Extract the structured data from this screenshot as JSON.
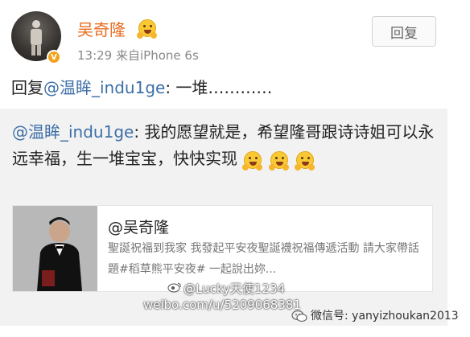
{
  "post": {
    "author": "吴奇隆",
    "time_source": "13:29  来自iPhone 6s",
    "reply_button": "回复",
    "verified_badge": "V",
    "reply_prefix": "回复",
    "reply_mention": "@温眸_indu1ge",
    "reply_body": ": 一堆…………"
  },
  "quoted": {
    "mention": "@温眸_indu1ge",
    "text": ": 我的愿望就是，希望隆哥跟诗诗姐可以永远幸福，生一堆宝宝，快快实现",
    "card": {
      "name": "@吴奇隆",
      "description": "聖誕祝福到我家 我發起平安夜聖誕襪祝福傳遞活動 請大家帶話題#稻草熊平安夜# 一起說出妳..."
    }
  },
  "watermarks": {
    "weibo_user": "@Lucky天使1234",
    "weibo_url": "weibo.com/u/5209068381",
    "wechat": "微信号: yanyizhoukan2013"
  },
  "icons": [
    "avatar",
    "verified-badge-icon",
    "hug-emoji-icon",
    "weibo-logo-icon",
    "wechat-logo-icon"
  ],
  "colors": {
    "name": "#e86c1f",
    "mention": "#3d6fa8",
    "quote_bg": "#f2f2f2",
    "badge": "#f2a21b"
  }
}
